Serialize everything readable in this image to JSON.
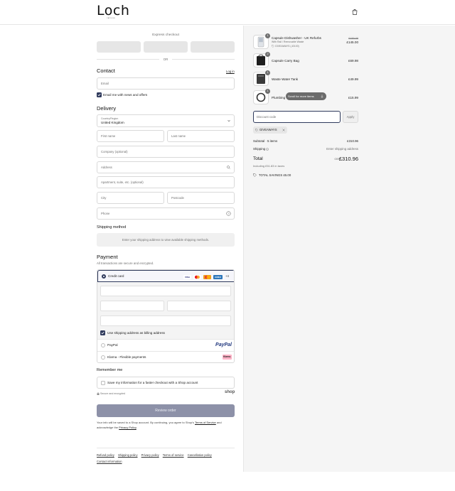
{
  "header": {
    "logo": "Loch",
    "logo_tagline": "CAPSULE"
  },
  "checkout": {
    "express_title": "Express checkout",
    "or": "OR",
    "contact": {
      "heading": "Contact",
      "login": "Log in",
      "email_placeholder": "Email",
      "news_label": "Email me with news and offers"
    },
    "delivery": {
      "heading": "Delivery",
      "country_label": "Country/Region",
      "country_value": "United Kingdom",
      "first_name": "First name",
      "last_name": "Last name",
      "company": "Company (optional)",
      "address": "Address",
      "apartment": "Apartment, suite, etc. (optional)",
      "city": "City",
      "postcode": "Postcode",
      "phone": "Phone"
    },
    "shipping": {
      "heading": "Shipping method",
      "notice": "Enter your shipping address to view available shipping methods."
    },
    "payment": {
      "heading": "Payment",
      "subtitle": "All transactions are secure and encrypted.",
      "credit_card": "Credit card",
      "card_brands": [
        "VISA",
        "MC",
        "AMEX"
      ],
      "more_brands": "+4",
      "billing_label": "Use shipping address as billing address",
      "paypal": "PayPal",
      "paypal_logo": "PayPal",
      "klarna": "Klarna - Flexible payments",
      "klarna_logo": "Klarna."
    },
    "remember": {
      "heading": "Remember me",
      "save_label": "Save my information for a faster checkout with a Shop account",
      "secure": "Secure and encrypted",
      "shop": "shop"
    },
    "review_button": "Review order",
    "legal_text": "Your info will be saved to a Shop account. By continuing, you agree to Shop's",
    "terms": "Terms of Service",
    "legal_and": "and acknowledge the",
    "privacy": "Privacy Policy",
    "footer_links": [
      "Refund policy",
      "Shipping policy",
      "Privacy policy",
      "Terms of service",
      "Cancellation policy",
      "Contact information"
    ]
  },
  "summary": {
    "items": [
      {
        "name": "Capsule Dishwasher - UK Refurbs",
        "variant": "With Rail / Removable Waste",
        "discount": "GIVEAWAYS (-£5.00)",
        "original_price": "£150.00",
        "price": "£145.00",
        "qty": "1"
      },
      {
        "name": "Capsule Carry Bag",
        "price": "£69.98",
        "qty": "2"
      },
      {
        "name": "Waste Water Tank",
        "price": "£49.99",
        "qty": "1"
      },
      {
        "name": "Plumbing",
        "price": "£15.99",
        "qty": "1"
      }
    ],
    "scroll_hint": "Scroll for more items",
    "discount_placeholder": "Discount code",
    "apply": "Apply",
    "chip": "GIVEAWAYS",
    "subtotal_label": "Subtotal · 5 items",
    "subtotal": "£310.96",
    "shipping_label": "Shipping",
    "shipping_value": "Enter shipping address",
    "total_label": "Total",
    "currency": "GBP",
    "total": "£310.96",
    "taxes": "Including £51.83 in taxes",
    "savings": "TOTAL SAVINGS £5.00"
  }
}
